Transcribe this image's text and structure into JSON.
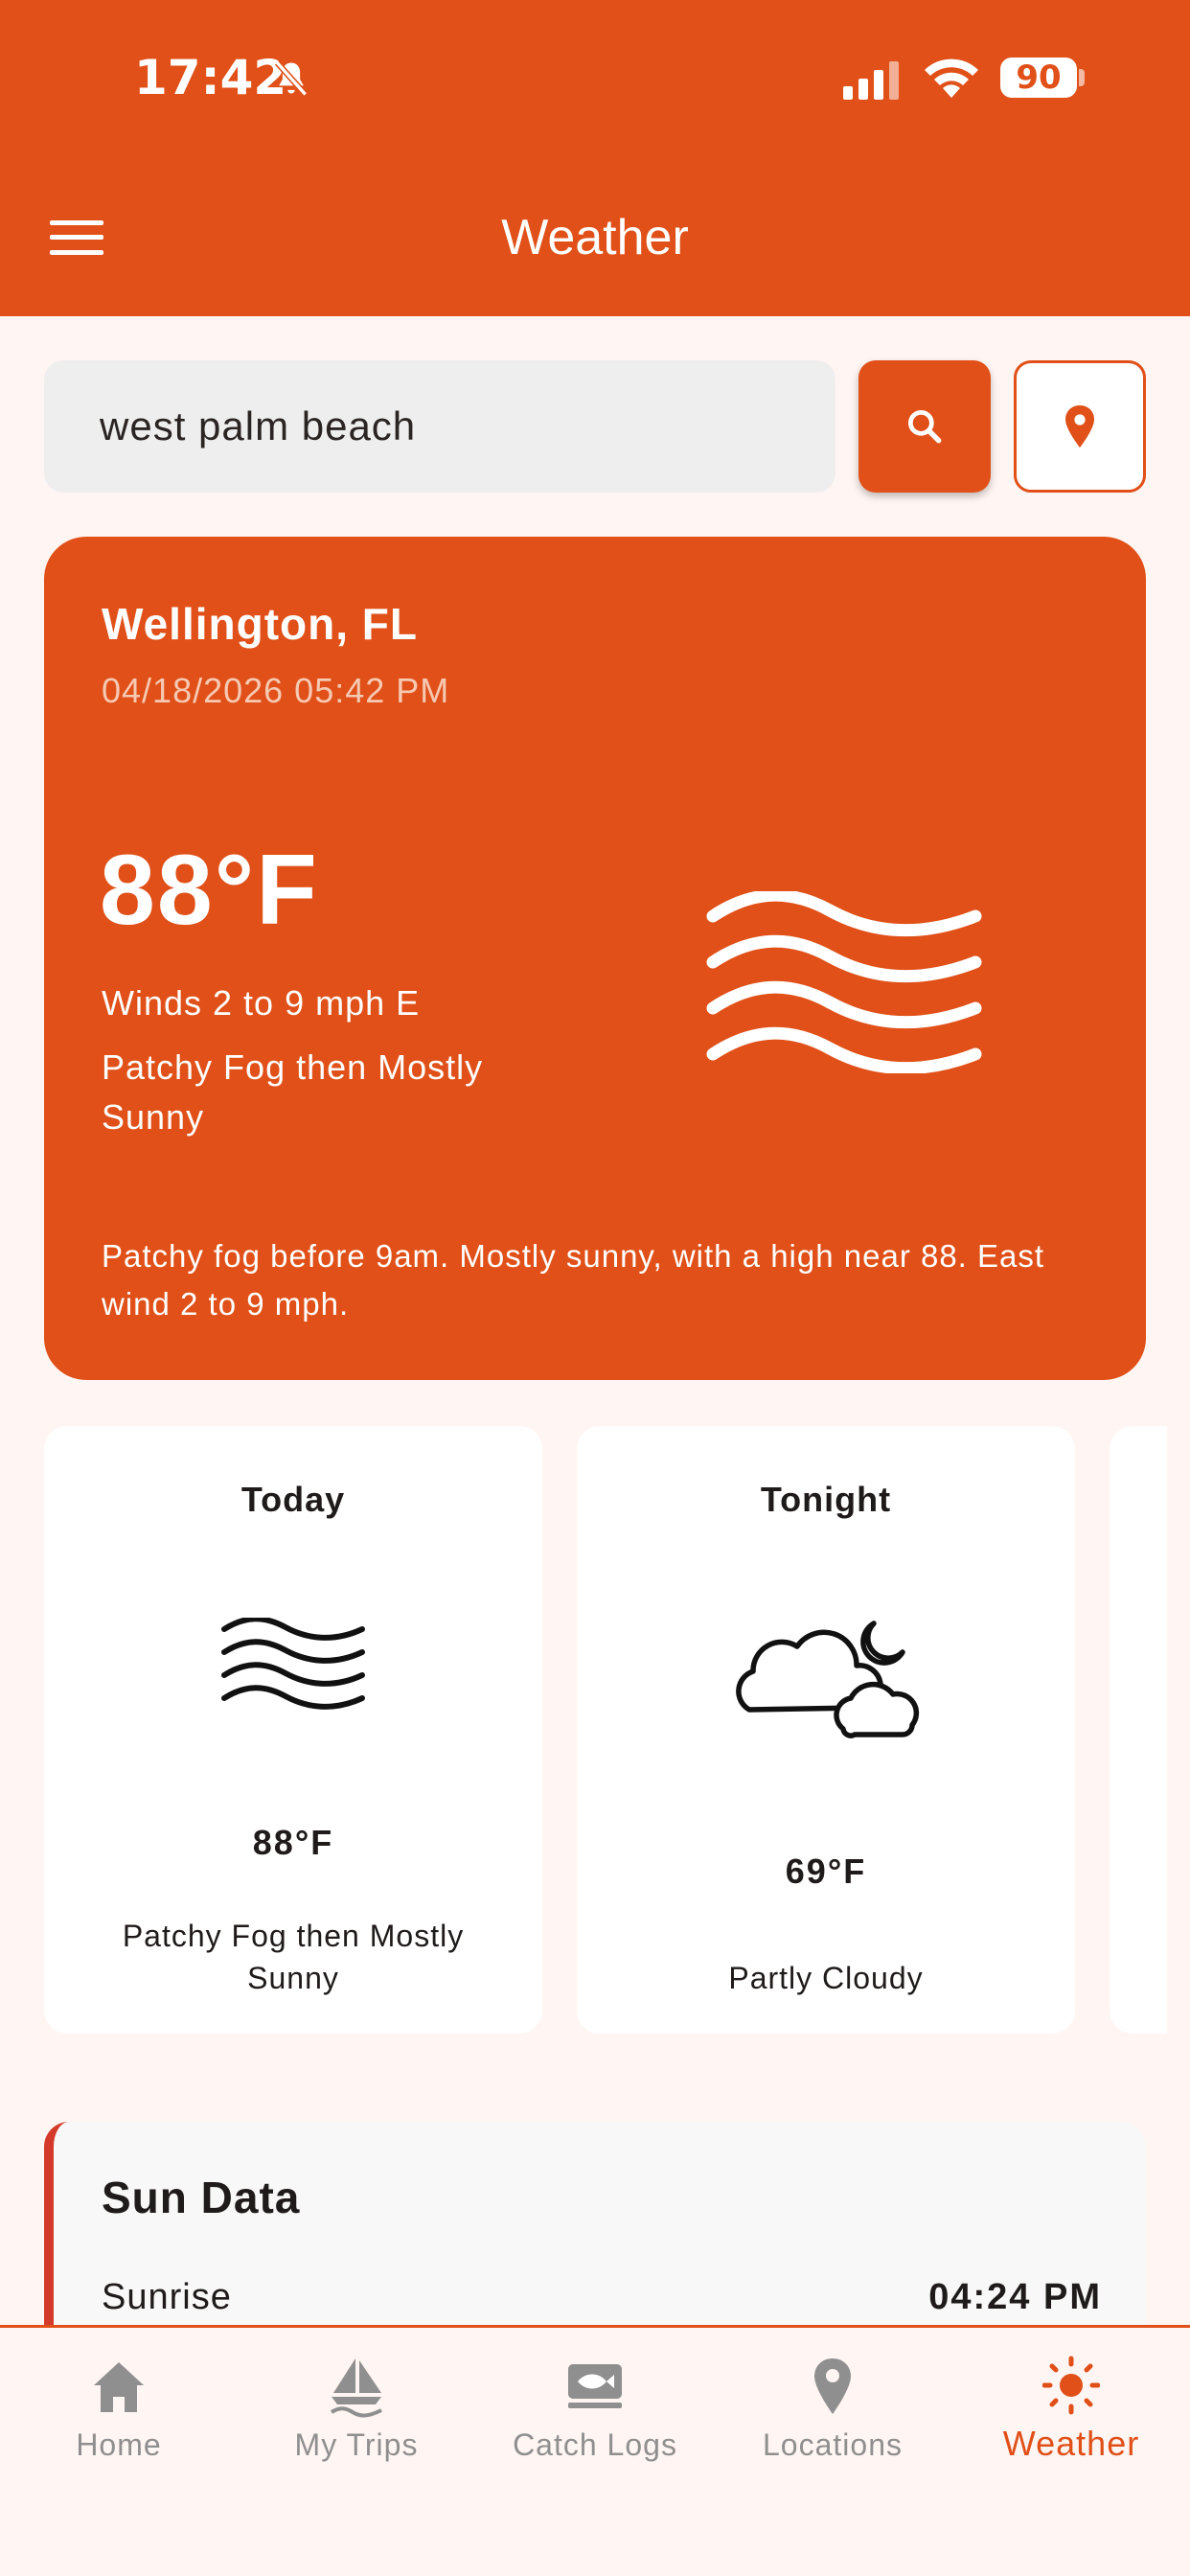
{
  "status_bar": {
    "time": "17:42",
    "battery": "90"
  },
  "app_bar": {
    "title": "Weather"
  },
  "search": {
    "value": "west palm beach",
    "placeholder": ""
  },
  "current": {
    "location": "Wellington, FL",
    "datetime": "04/18/2026 05:42 PM",
    "temperature": "88°F",
    "winds": "Winds 2 to 9 mph E",
    "short_forecast": "Patchy Fog then Mostly Sunny",
    "detailed_forecast": "Patchy fog before 9am. Mostly sunny, with a high near 88. East wind 2 to 9 mph.",
    "icon": "fog-icon"
  },
  "periods": [
    {
      "name": "Today",
      "temperature": "88°F",
      "description": "Patchy Fog then Mostly Sunny",
      "icon": "fog-icon"
    },
    {
      "name": "Tonight",
      "temperature": "69°F",
      "description": "Partly Cloudy",
      "icon": "partly-cloudy-night-icon"
    }
  ],
  "sun_data": {
    "title": "Sun Data",
    "sunrise_label": "Sunrise",
    "sunrise_value": "04:24 PM"
  },
  "nav": [
    {
      "label": "Home",
      "icon": "home-icon"
    },
    {
      "label": "My Trips",
      "icon": "sailboat-icon"
    },
    {
      "label": "Catch Logs",
      "icon": "fish-log-icon"
    },
    {
      "label": "Locations",
      "icon": "map-pin-icon"
    },
    {
      "label": "Weather",
      "icon": "sun-icon",
      "active": true
    }
  ],
  "colors": {
    "primary": "#e05018",
    "background": "#fff5f2",
    "sun_accent": "#d43a2a",
    "nav_inactive": "#8f8f8f"
  }
}
